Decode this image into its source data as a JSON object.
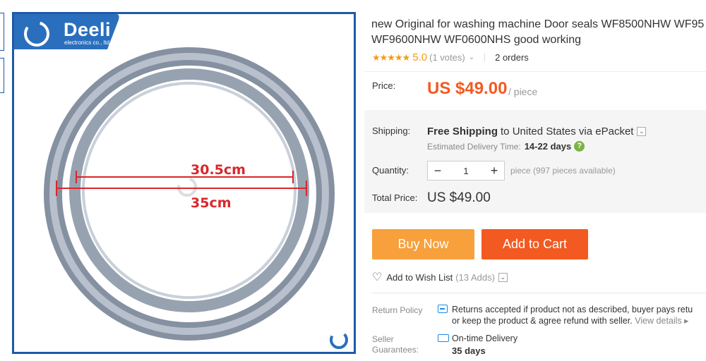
{
  "image": {
    "logo_name": "Deeli",
    "logo_sub": "electronics co., ltd",
    "dim_inner": "30.5cm",
    "dim_outer": "35cm"
  },
  "product": {
    "title_line1": "new Original for washing machine Door seals WF8500NHW WF95",
    "title_line2": "WF9600NHW WF0600NHS good working",
    "stars": "★★★★★",
    "rating": "5.0",
    "votes": "(1 votes)",
    "orders": "2 orders"
  },
  "price": {
    "label": "Price:",
    "value": "US $49.00",
    "unit": "/ piece"
  },
  "shipping": {
    "label": "Shipping:",
    "free_text": "Free Shipping",
    "to_text": "to United States via ePacket",
    "est_label": "Estimated Delivery Time:",
    "est_value": "14-22 days"
  },
  "quantity": {
    "label": "Quantity:",
    "value": "1",
    "available": "piece (997 pieces available)"
  },
  "total": {
    "label": "Total Price:",
    "value": "US $49.00"
  },
  "actions": {
    "buy_now": "Buy Now",
    "add_to_cart": "Add to Cart",
    "wish_list": "Add to Wish List",
    "wish_count": "(13 Adds)"
  },
  "policy": {
    "return_label": "Return Policy",
    "return_line1": "Returns accepted if product not as described, buyer pays retu",
    "return_line2": "or keep the product & agree refund with seller.",
    "view_details": "View details",
    "seller_label_1": "Seller",
    "seller_label_2": "Guarantees:",
    "ontime": "On-time Delivery",
    "days": "35 days"
  },
  "colors": {
    "price": "#f25a21",
    "buy_now": "#f7a03c",
    "add_to_cart": "#f25a21",
    "frame": "#1e5aa8",
    "dimension": "#d9272b",
    "stars": "#f39c12"
  }
}
